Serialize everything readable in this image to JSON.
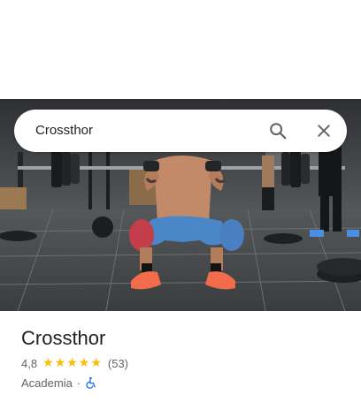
{
  "search": {
    "query": "Crossthor",
    "search_icon": "search-icon",
    "close_icon": "close-icon"
  },
  "photo": {
    "subject": "gym-photo-squat"
  },
  "place": {
    "name": "Crossthor",
    "rating": "4,8",
    "stars": 5,
    "review_count": "(53)",
    "category": "Academia",
    "separator": "·",
    "accessibility_icon": "wheelchair-icon"
  },
  "colors": {
    "star": "#fbbc04",
    "accessible": "#1a73e8",
    "text_primary": "#202124",
    "text_secondary": "#5f6368"
  }
}
